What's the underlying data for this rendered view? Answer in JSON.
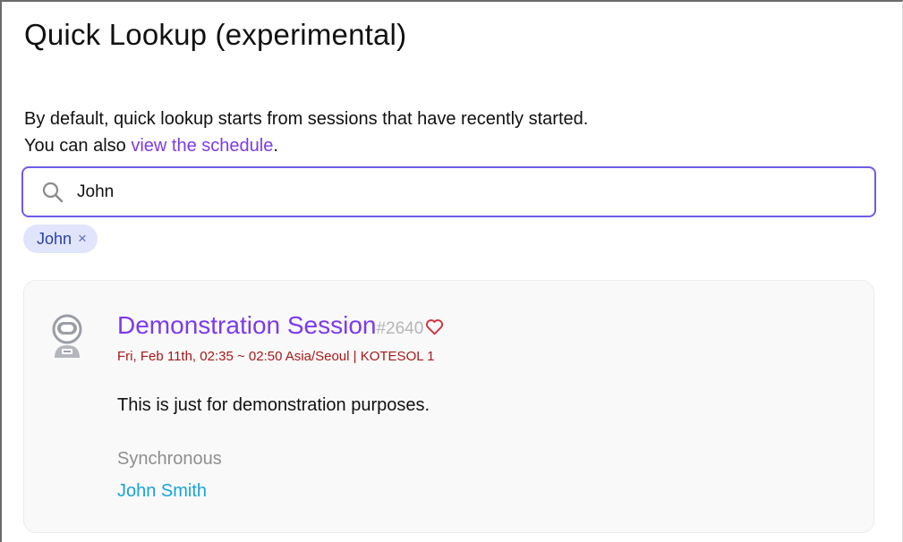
{
  "page": {
    "title": "Quick Lookup (experimental)",
    "intro_line1": "By default, quick lookup starts from sessions that have recently started.",
    "intro_line2_prefix": "You can also ",
    "intro_link": "view the schedule",
    "intro_line2_suffix": "."
  },
  "search": {
    "value": "John",
    "placeholder": "",
    "icon": "search-icon"
  },
  "filters": [
    {
      "label": "John",
      "remove_glyph": "×"
    }
  ],
  "results": [
    {
      "title": "Demonstration Session",
      "number": "#2640",
      "datetime": "Fri, Feb 11th, 02:35 ~ 02:50 Asia/Seoul",
      "separator": " | ",
      "venue": "KOTESOL 1",
      "description": "This is just for demonstration purposes.",
      "type": "Synchronous",
      "speaker": "John Smith",
      "avatar_icon": "astronaut-icon",
      "favorite_icon": "heart-outline-icon"
    }
  ],
  "colors": {
    "accent": "#7c3aed",
    "search_border": "#6d5ce8",
    "chip_bg": "#e0e5fb",
    "chip_text": "#2b3fa8",
    "meta_red": "#a81818",
    "speaker_blue": "#1aa3d9",
    "muted": "#8f8f8f",
    "heart": "#d62f3c"
  }
}
